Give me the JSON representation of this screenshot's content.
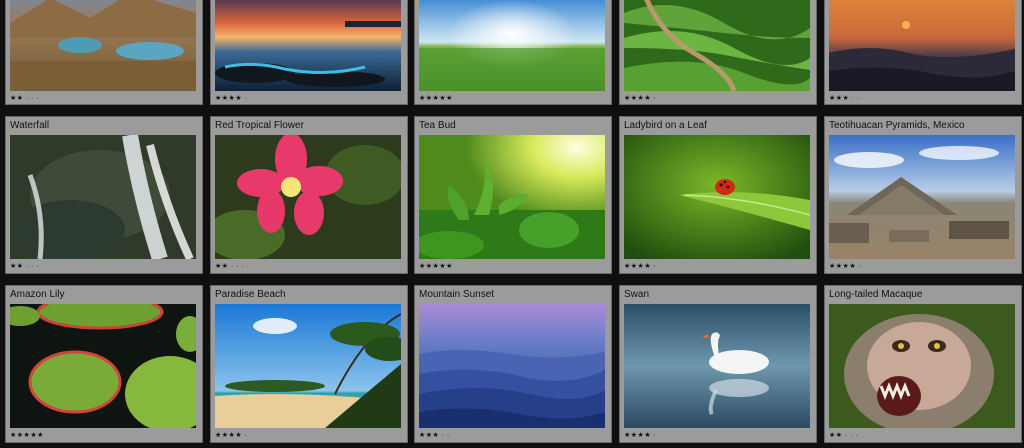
{
  "grid": {
    "rows": [
      [
        {
          "title": "",
          "stars": "★★ · · ·",
          "rating": 2,
          "image": "mountain-lake-valley-photo"
        },
        {
          "title": "",
          "stars": "★★★★ ·",
          "rating": 4,
          "image": "sunset-over-rocky-coast-photo"
        },
        {
          "title": "",
          "stars": "★★★★★",
          "rating": 5,
          "image": "sunburst-over-green-field-photo"
        },
        {
          "title": "",
          "stars": "★★★★ ·",
          "rating": 4,
          "image": "tea-plantation-hills-photo"
        },
        {
          "title": "",
          "stars": "★★★ · ·",
          "rating": 3,
          "image": "orange-mountain-sunset-photo"
        }
      ],
      [
        {
          "title": "Waterfall",
          "stars": "★★ · · ·",
          "rating": 2,
          "image": "waterfall-over-rock-photo"
        },
        {
          "title": "Red Tropical Flower",
          "stars": "★★ · · ·",
          "rating": 2,
          "image": "pink-tropical-flower-photo"
        },
        {
          "title": "Tea Bud",
          "stars": "★★★★★",
          "rating": 5,
          "image": "tea-bud-sunlight-photo"
        },
        {
          "title": "Ladybird on a Leaf",
          "stars": "★★★★ ·",
          "rating": 4,
          "image": "ladybird-on-leaf-photo"
        },
        {
          "title": "Teotihuacan Pyramids, Mexico",
          "stars": "★★★★ ·",
          "rating": 4,
          "image": "teotihuacan-pyramid-photo"
        }
      ],
      [
        {
          "title": "Amazon Lily",
          "stars": "★★★★★",
          "rating": 5,
          "image": "amazon-lily-pads-photo"
        },
        {
          "title": "Paradise Beach",
          "stars": "★★★★ ·",
          "rating": 4,
          "image": "tropical-beach-palms-photo"
        },
        {
          "title": "Mountain Sunset",
          "stars": "★★★ · ·",
          "rating": 3,
          "image": "blue-mountain-ridges-photo"
        },
        {
          "title": "Swan",
          "stars": "★★★★ ·",
          "rating": 4,
          "image": "white-swan-photo"
        },
        {
          "title": "Long-tailed Macaque",
          "stars": "★★ · · ·",
          "rating": 2,
          "image": "macaque-monkey-photo"
        }
      ]
    ]
  }
}
